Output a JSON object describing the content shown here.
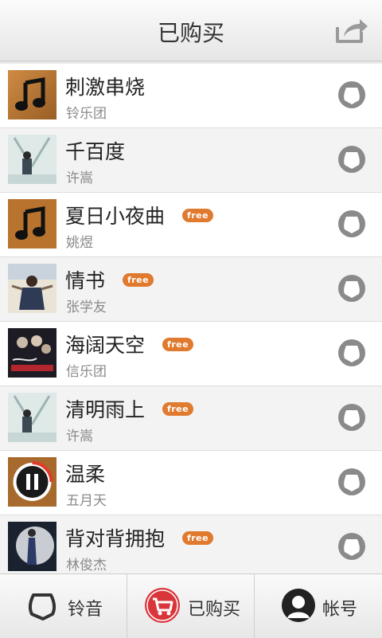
{
  "header": {
    "title": "已购买"
  },
  "songs": [
    {
      "title": "刺激串烧",
      "artist": "铃乐团",
      "free": "",
      "cover": "note"
    },
    {
      "title": "千百度",
      "artist": "许嵩",
      "free": "",
      "cover": "photo-light"
    },
    {
      "title": "夏日小夜曲",
      "artist": "姚煜",
      "free": "free",
      "cover": "note"
    },
    {
      "title": "情书",
      "artist": "张学友",
      "free": "free",
      "cover": "photo-people"
    },
    {
      "title": "海阔天空",
      "artist": "信乐团",
      "free": "free",
      "cover": "photo-band"
    },
    {
      "title": "清明雨上",
      "artist": "许嵩",
      "free": "free",
      "cover": "photo-light"
    },
    {
      "title": "温柔",
      "artist": "五月天",
      "free": "",
      "cover": "pause"
    },
    {
      "title": "背对背拥抱",
      "artist": "林俊杰",
      "free": "free",
      "cover": "photo-moon"
    }
  ],
  "tabs": [
    {
      "label": "铃音",
      "icon": "bell-icon"
    },
    {
      "label": "已购买",
      "icon": "cart-icon"
    },
    {
      "label": "帐号",
      "icon": "account-icon"
    }
  ],
  "colors": {
    "accent": "#e07a2e",
    "cart": "#d9363b"
  }
}
